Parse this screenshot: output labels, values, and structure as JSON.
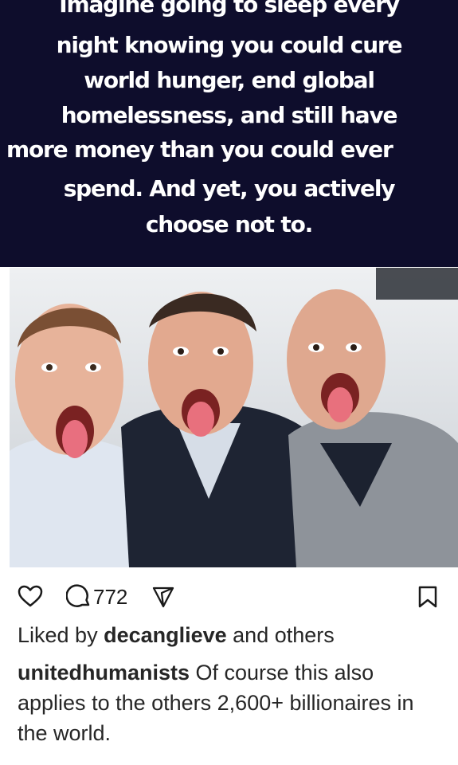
{
  "meme": {
    "lines": [
      "Imagine going to sleep every",
      "night knowing you could cure",
      "world hunger, end global",
      "homelessness, and still have",
      "more money than you could ever",
      "spend. And yet, you actively",
      "choose not to."
    ]
  },
  "post": {
    "comment_count": "772",
    "liked_by_prefix": "Liked by ",
    "liked_by_user": "decanglieve",
    "liked_by_suffix": " and others",
    "caption_user": "unitedhumanists",
    "caption_text": " Of course this also applies to the others 2,600+ billionaires in the world."
  },
  "icons": {
    "like": "heart-icon",
    "comment": "comment-bubble-icon",
    "share": "send-icon",
    "save": "bookmark-icon"
  },
  "colors": {
    "header_bg": "#0e0d2c",
    "text": "#262626",
    "icon": "#1a1a1a"
  }
}
